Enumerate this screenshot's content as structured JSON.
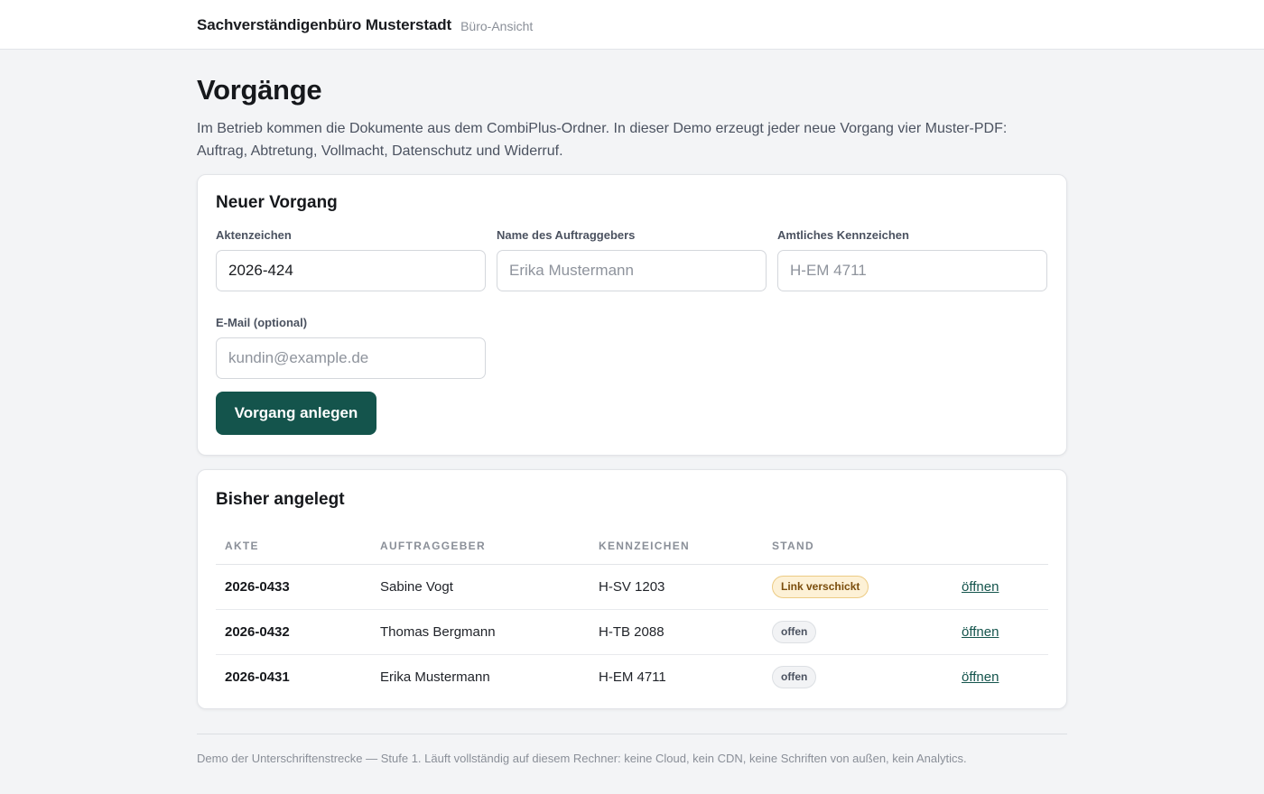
{
  "header": {
    "brand": "Sachverständigenbüro Musterstadt",
    "subtitle": "Büro-Ansicht"
  },
  "page": {
    "title": "Vorgänge",
    "intro": "Im Betrieb kommen die Dokumente aus dem CombiPlus-Ordner. In dieser Demo erzeugt jeder neue Vorgang vier Muster-PDF: Auftrag, Abtretung, Vollmacht, Datenschutz und Widerruf."
  },
  "new_case": {
    "title": "Neuer Vorgang",
    "aktenzeichen_label": "Aktenzeichen",
    "aktenzeichen_value": "2026-424",
    "name_label": "Name des Auftraggebers",
    "name_placeholder": "Erika Mustermann",
    "kennzeichen_label": "Amtliches Kennzeichen",
    "kennzeichen_placeholder": "H-EM 4711",
    "email_label": "E-Mail (optional)",
    "email_placeholder": "kundin@example.de",
    "submit_label": "Vorgang anlegen"
  },
  "list": {
    "title": "Bisher angelegt",
    "columns": [
      "AKTE",
      "AUFTRAGGEBER",
      "KENNZEICHEN",
      "STAND",
      ""
    ],
    "rows": [
      {
        "akte": "2026-0433",
        "auftraggeber": "Sabine Vogt",
        "kennzeichen": "H-SV 1203",
        "stand": "Link verschickt",
        "action": "öffnen"
      },
      {
        "akte": "2026-0432",
        "auftraggeber": "Thomas Bergmann",
        "kennzeichen": "H-TB 2088",
        "stand": "offen",
        "action": "öffnen"
      },
      {
        "akte": "2026-0431",
        "auftraggeber": "Erika Mustermann",
        "kennzeichen": "H-EM 4711",
        "stand": "offen",
        "action": "öffnen"
      }
    ]
  },
  "footer": {
    "text": "Demo der Unterschriftenstrecke — Stufe 1. Läuft vollständig auf diesem Rechner: keine Cloud, kein CDN, keine Schriften von außen, kein Analytics."
  },
  "colors": {
    "accent": "#14544c",
    "badge_sent_bg": "#fdf1d6",
    "badge_open_bg": "#f2f3f5",
    "page_bg": "#f3f4f6"
  }
}
